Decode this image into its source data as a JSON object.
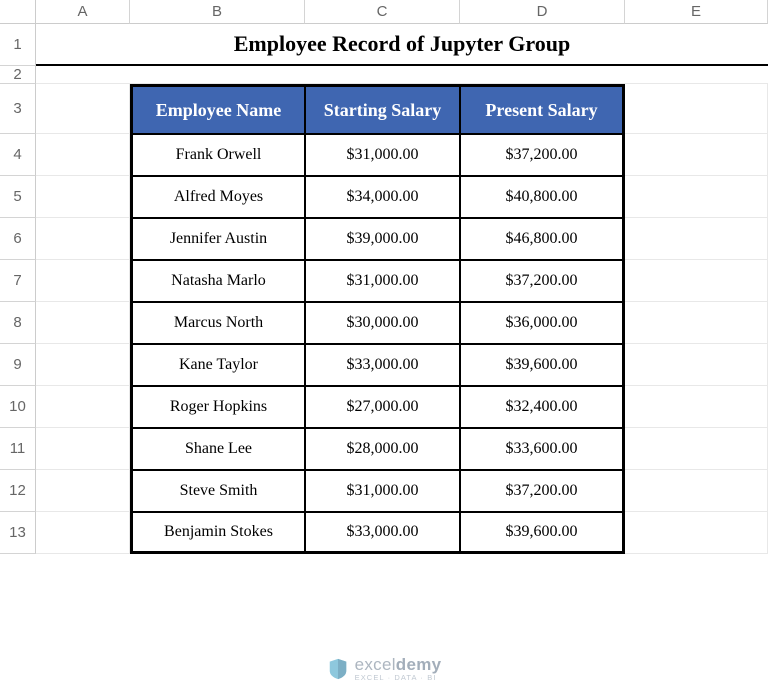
{
  "columns": [
    "A",
    "B",
    "C",
    "D",
    "E"
  ],
  "rows": [
    "1",
    "2",
    "3",
    "4",
    "5",
    "6",
    "7",
    "8",
    "9",
    "10",
    "11",
    "12",
    "13"
  ],
  "title": "Employee Record of Jupyter Group",
  "table": {
    "headers": [
      "Employee Name",
      "Starting Salary",
      "Present Salary"
    ],
    "data": [
      [
        "Frank Orwell",
        "$31,000.00",
        "$37,200.00"
      ],
      [
        "Alfred Moyes",
        "$34,000.00",
        "$40,800.00"
      ],
      [
        "Jennifer Austin",
        "$39,000.00",
        "$46,800.00"
      ],
      [
        "Natasha Marlo",
        "$31,000.00",
        "$37,200.00"
      ],
      [
        "Marcus North",
        "$30,000.00",
        "$36,000.00"
      ],
      [
        "Kane Taylor",
        "$33,000.00",
        "$39,600.00"
      ],
      [
        "Roger Hopkins",
        "$27,000.00",
        "$32,400.00"
      ],
      [
        "Shane Lee",
        "$28,000.00",
        "$33,600.00"
      ],
      [
        "Steve Smith",
        "$31,000.00",
        "$37,200.00"
      ],
      [
        "Benjamin Stokes",
        "$33,000.00",
        "$39,600.00"
      ]
    ]
  },
  "watermark": {
    "brand_prefix": "excel",
    "brand_suffix": "demy",
    "tagline": "EXCEL · DATA · BI"
  }
}
